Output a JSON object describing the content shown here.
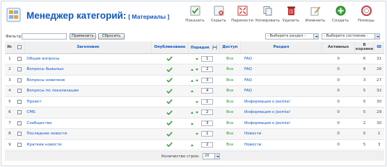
{
  "header": {
    "title": "Менеджер категорий:",
    "subtitle": "[ Материалы ]"
  },
  "toolbar": [
    {
      "id": "publish",
      "label": "Показать",
      "icon": "publish-icon"
    },
    {
      "id": "unpublish",
      "label": "Скрыть",
      "icon": "unpublish-icon"
    },
    {
      "id": "move",
      "label": "Перенести",
      "icon": "move-icon"
    },
    {
      "id": "copy",
      "label": "Копировать",
      "icon": "copy-icon"
    },
    {
      "id": "delete",
      "label": "Удалить",
      "icon": "trash-icon"
    },
    {
      "id": "edit",
      "label": "Изменить",
      "icon": "edit-icon"
    },
    {
      "id": "new",
      "label": "Создать",
      "icon": "add-icon"
    },
    {
      "id": "help",
      "label": "Помощь",
      "icon": "help-icon"
    }
  ],
  "filter": {
    "label": "Фильтр:",
    "value": "",
    "apply_label": "Применить",
    "reset_label": "Сбросить",
    "section_select": "- Выберите раздел -",
    "state_select": "- Выберите состояние -"
  },
  "columns": {
    "num": "№",
    "title": "Заголовок",
    "published": "Опубликовано",
    "order": "Порядок",
    "access": "Доступ",
    "section": "Раздел",
    "active": "Активных",
    "trash": "В корзине",
    "id": "ID"
  },
  "rows": [
    {
      "num": "1",
      "title": "Общие вопросы",
      "published": true,
      "order": "1",
      "access": "Все",
      "section": "FAQ",
      "active": "0",
      "trash": "6",
      "id": "31",
      "up": false,
      "down": true
    },
    {
      "num": "2",
      "title": "Вопросы бывалых",
      "published": true,
      "order": "2",
      "access": "Все",
      "section": "FAQ",
      "active": "0",
      "trash": "8",
      "id": "26",
      "up": true,
      "down": true
    },
    {
      "num": "3",
      "title": "Вопросы новичков",
      "published": true,
      "order": "3",
      "access": "Все",
      "section": "FAQ",
      "active": "0",
      "trash": "3",
      "id": "27",
      "up": true,
      "down": true
    },
    {
      "num": "4",
      "title": "Вопросы по локализации",
      "published": true,
      "order": "4",
      "access": "Все",
      "section": "FAQ",
      "active": "0",
      "trash": "5",
      "id": "32",
      "up": true,
      "down": false
    },
    {
      "num": "5",
      "title": "Проект",
      "published": true,
      "order": "1",
      "access": "Все",
      "section": "Информация о Joomla!",
      "active": "0",
      "trash": "5",
      "id": "30",
      "up": false,
      "down": true
    },
    {
      "num": "6",
      "title": "CMS",
      "published": true,
      "order": "2",
      "access": "Все",
      "section": "Информация о Joomla!",
      "active": "0",
      "trash": "5",
      "id": "29",
      "up": true,
      "down": true
    },
    {
      "num": "7",
      "title": "Сообщество",
      "published": true,
      "order": "3",
      "access": "Все",
      "section": "Информация о Joomla!",
      "active": "0",
      "trash": "2",
      "id": "30",
      "up": true,
      "down": false
    },
    {
      "num": "8",
      "title": "Последние новости",
      "published": true,
      "order": "1",
      "access": "Все",
      "section": "Новости",
      "active": "0",
      "trash": "5",
      "id": "1",
      "up": false,
      "down": true
    },
    {
      "num": "9",
      "title": "Краткие новости",
      "published": true,
      "order": "2",
      "access": "Все",
      "section": "Новости",
      "active": "0",
      "trash": "5",
      "id": "3",
      "up": true,
      "down": false
    }
  ],
  "pager": {
    "label": "Количество строк:",
    "value": "20"
  }
}
